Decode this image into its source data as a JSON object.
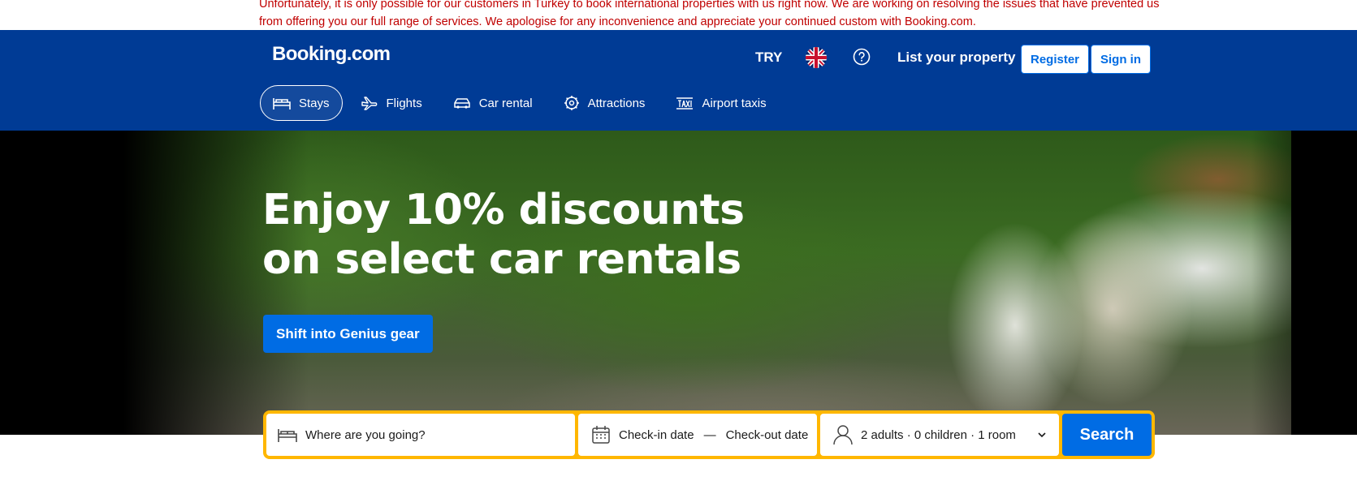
{
  "notice": {
    "text": "Unfortunately, it is only possible for our customers in Turkey to book international properties with us right now. We are working on resolving the issues that have prevented us from offering you our full range of services. We apologise for any inconvenience and appreciate your continued custom with Booking.com.",
    "color": "#c00000"
  },
  "header": {
    "logo": "Booking.com",
    "currency": "TRY",
    "language_flag": "uk-flag-icon",
    "help_icon": "help-circle-icon",
    "list_property": "List your property",
    "register": "Register",
    "sign_in": "Sign in",
    "bg_color": "#003b95"
  },
  "nav": {
    "items": [
      {
        "label": "Stays",
        "icon": "bed-icon",
        "active": true
      },
      {
        "label": "Flights",
        "icon": "plane-icon"
      },
      {
        "label": "Car rental",
        "icon": "car-icon"
      },
      {
        "label": "Attractions",
        "icon": "attractions-icon"
      },
      {
        "label": "Airport taxis",
        "icon": "taxi-icon"
      }
    ]
  },
  "hero": {
    "title": "Enjoy 10% discounts on select car rentals",
    "cta": "Shift into Genius gear"
  },
  "search": {
    "destination_placeholder": "Where are you going?",
    "checkin": "Check-in date",
    "separator": "—",
    "checkout": "Check-out date",
    "occupancy": "2 adults · 0 children · 1 room",
    "button": "Search",
    "border_color": "#ffb700",
    "accent": "#006ce4"
  }
}
